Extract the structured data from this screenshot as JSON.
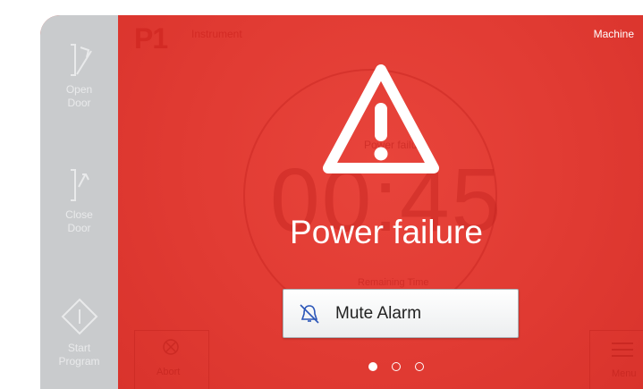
{
  "sidebar": {
    "items": [
      {
        "label": "Open\nDoor",
        "icon": "open-door-icon"
      },
      {
        "label": "Close\nDoor",
        "icon": "close-door-icon"
      },
      {
        "label": "Start\nProgram",
        "icon": "start-program-icon"
      }
    ]
  },
  "header": {
    "program": "P1",
    "instrument": "Instrument",
    "machine": "Machine"
  },
  "background": {
    "time": "00:45",
    "status": "Power failure",
    "remaining_label": "Remaining Time",
    "abort_label": "Abort",
    "menu_label": "Menu"
  },
  "alert": {
    "icon": "warning-triangle-icon",
    "title": "Power failure",
    "mute_label": "Mute Alarm",
    "mute_icon": "alarm-mute-icon"
  },
  "pagination": {
    "current": 1,
    "total": 3
  },
  "colors": {
    "alert_red": "#e23b33",
    "sidebar_gray": "#c9cbcd"
  }
}
